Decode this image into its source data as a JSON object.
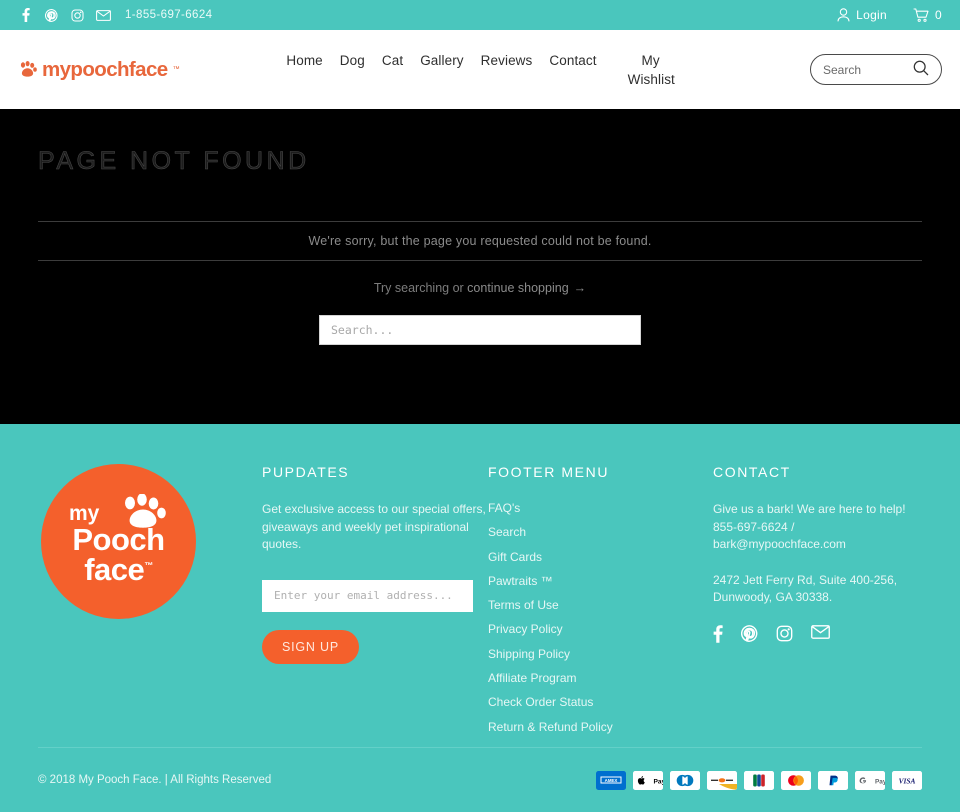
{
  "topbar": {
    "social": [
      {
        "name": "facebook-icon",
        "label": "Facebook"
      },
      {
        "name": "pinterest-icon",
        "label": "Pinterest"
      },
      {
        "name": "instagram-icon",
        "label": "Instagram"
      },
      {
        "name": "email-icon",
        "label": "Email"
      }
    ],
    "phone": "1-855-697-6624",
    "login_label": "Login",
    "cart_count": "0"
  },
  "header": {
    "logo_text": "mypoochface",
    "logo_tm": "™",
    "nav": [
      {
        "label": "Home"
      },
      {
        "label": "Dog"
      },
      {
        "label": "Cat"
      },
      {
        "label": "Gallery"
      },
      {
        "label": "Reviews"
      },
      {
        "label": "Contact"
      },
      {
        "label": "My Wishlist"
      }
    ],
    "search_placeholder": "Search",
    "search_value": ""
  },
  "main": {
    "title": "PAGE NOT FOUND",
    "sorry": "We're sorry, but the page you requested could not be found.",
    "try_prefix": "Try searching or ",
    "try_link": "continue shopping",
    "try_arrow": "→",
    "search_placeholder": "Search...",
    "search_value": ""
  },
  "footer": {
    "logo": {
      "my": "my",
      "pooch": "Pooch",
      "face": "face",
      "tm": "™"
    },
    "pupdates": {
      "heading": "PUPDATES",
      "body": "Get exclusive access to our special offers, giveaways and weekly pet inspirational quotes.",
      "email_placeholder": "Enter your email address...",
      "email_value": "",
      "signup_label": "SIGN UP"
    },
    "menu": {
      "heading": "FOOTER MENU",
      "links": [
        {
          "label": "FAQ's"
        },
        {
          "label": "Search"
        },
        {
          "label": "Gift Cards"
        },
        {
          "label": "Pawtraits ™"
        },
        {
          "label": "Terms of Use"
        },
        {
          "label": "Privacy Policy"
        },
        {
          "label": "Shipping Policy"
        },
        {
          "label": "Affiliate Program"
        },
        {
          "label": "Check Order Status"
        },
        {
          "label": "Return & Refund Policy"
        }
      ]
    },
    "contact": {
      "heading": "CONTACT",
      "help": "Give us a bark! We are here to help! 855-697-6624 / bark@mypoochface.com",
      "address": "2472 Jett Ferry Rd, Suite 400-256, Dunwoody, GA  30338.",
      "social": [
        {
          "name": "facebook-icon",
          "label": "Facebook"
        },
        {
          "name": "pinterest-icon",
          "label": "Pinterest"
        },
        {
          "name": "instagram-icon",
          "label": "Instagram"
        },
        {
          "name": "email-icon",
          "label": "Email"
        }
      ]
    },
    "copyright": "© 2018 My Pooch Face. | All Rights Reserved",
    "payments": [
      {
        "name": "amex",
        "label": "AMEX"
      },
      {
        "name": "apple-pay",
        "label": "Pay"
      },
      {
        "name": "diners-club",
        "label": "Diners"
      },
      {
        "name": "discover",
        "label": "Discover"
      },
      {
        "name": "jcb",
        "label": "JCB"
      },
      {
        "name": "mastercard",
        "label": "Mastercard"
      },
      {
        "name": "paypal",
        "label": "PayPal"
      },
      {
        "name": "google-pay",
        "label": "Pay"
      },
      {
        "name": "visa",
        "label": "VISA"
      }
    ]
  },
  "colors": {
    "teal": "#4ac6bd",
    "orange": "#f4602c",
    "black": "#000000"
  }
}
